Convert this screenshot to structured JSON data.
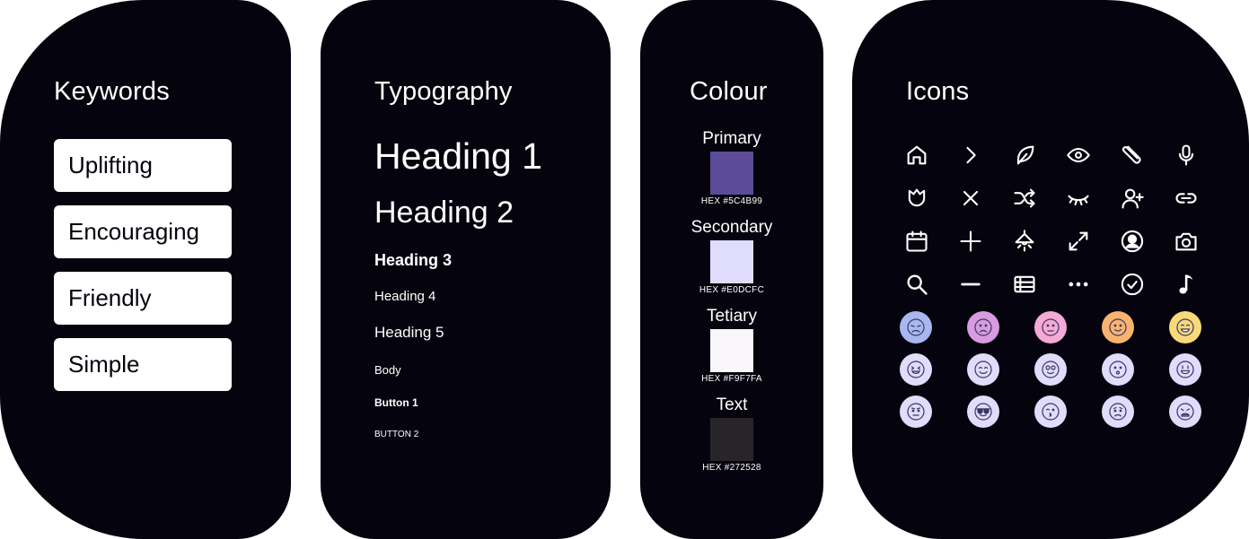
{
  "keywords": {
    "title": "Keywords",
    "items": [
      "Uplifting",
      "Encouraging",
      "Friendly",
      "Simple"
    ]
  },
  "typography": {
    "title": "Typography",
    "h1": "Heading 1",
    "h2": "Heading 2",
    "h3": "Heading 3",
    "h4": "Heading 4",
    "h5": "Heading 5",
    "body": "Body",
    "button1": "Button 1",
    "button2": "BUTTON 2"
  },
  "colour": {
    "title": "Colour",
    "swatches": [
      {
        "name": "Primary",
        "hex_label": "HEX #5C4B99",
        "color": "#5C4B99"
      },
      {
        "name": "Secondary",
        "hex_label": "HEX #E0DCFC",
        "color": "#E0DCFC"
      },
      {
        "name": "Tetiary",
        "hex_label": "HEX #F9F7FA",
        "color": "#F9F7FA"
      },
      {
        "name": "Text",
        "hex_label": "HEX #272528",
        "color": "#272528"
      }
    ]
  },
  "icons": {
    "title": "Icons",
    "rows": [
      [
        "home-icon",
        "chevron-right-icon",
        "feather-icon",
        "eye-icon",
        "paperclip-icon",
        "microphone-icon"
      ],
      [
        "tulip-icon",
        "close-icon",
        "shuffle-icon",
        "eye-closed-icon",
        "add-user-icon",
        "link-icon"
      ],
      [
        "calendar-icon",
        "plus-icon",
        "lamp-icon",
        "expand-icon",
        "user-circle-icon",
        "camera-icon"
      ],
      [
        "search-icon",
        "minus-icon",
        "table-icon",
        "more-icon",
        "check-circle-icon",
        "music-note-icon"
      ]
    ],
    "emoji_rows": [
      [
        {
          "name": "tired-face-icon",
          "color": "#A7B8F0"
        },
        {
          "name": "sad-face-icon",
          "color": "#D79BE0"
        },
        {
          "name": "worried-face-icon",
          "color": "#F4A9D6"
        },
        {
          "name": "smile-face-icon",
          "color": "#F8B46E"
        },
        {
          "name": "grin-face-icon",
          "color": "#F8D97A"
        }
      ],
      [
        {
          "name": "tongue-face-icon",
          "color": "#E0DCFC"
        },
        {
          "name": "happy-face-icon",
          "color": "#E0DCFC"
        },
        {
          "name": "heart-eyes-face-icon",
          "color": "#E0DCFC"
        },
        {
          "name": "surprised-face-icon",
          "color": "#E0DCFC"
        },
        {
          "name": "big-grin-face-icon",
          "color": "#E0DCFC"
        }
      ],
      [
        {
          "name": "skeptical-face-icon",
          "color": "#E0DCFC"
        },
        {
          "name": "sunglasses-face-icon",
          "color": "#E0DCFC"
        },
        {
          "name": "kiss-face-icon",
          "color": "#E0DCFC"
        },
        {
          "name": "frown-face-icon",
          "color": "#E0DCFC"
        },
        {
          "name": "weary-face-icon",
          "color": "#E0DCFC"
        }
      ]
    ]
  }
}
